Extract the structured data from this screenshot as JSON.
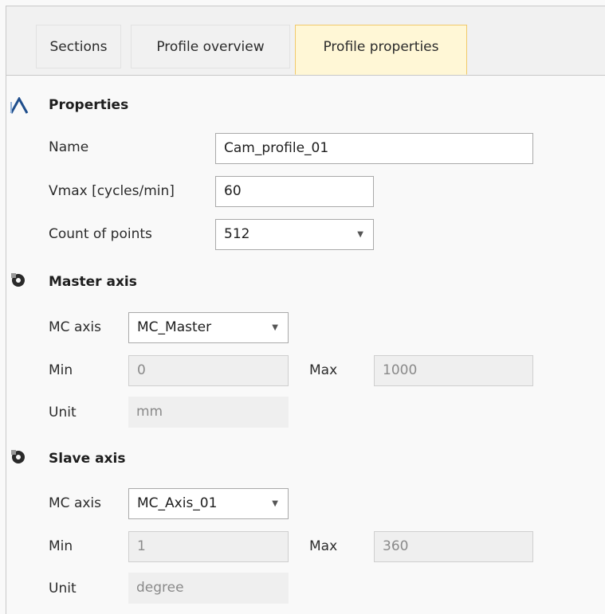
{
  "tabs": [
    {
      "label": "Sections"
    },
    {
      "label": "Profile overview"
    },
    {
      "label": "Profile properties"
    }
  ],
  "properties": {
    "title": "Properties",
    "name_label": "Name",
    "name_value": "Cam_profile_01",
    "vmax_label": "Vmax [cycles/min]",
    "vmax_value": "60",
    "count_label": "Count of points",
    "count_value": "512"
  },
  "master_axis": {
    "title": "Master axis",
    "mc_axis_label": "MC axis",
    "mc_axis_value": "MC_Master",
    "min_label": "Min",
    "min_value": "0",
    "max_label": "Max",
    "max_value": "1000",
    "unit_label": "Unit",
    "unit_value": "mm"
  },
  "slave_axis": {
    "title": "Slave axis",
    "mc_axis_label": "MC axis",
    "mc_axis_value": "MC_Axis_01",
    "min_label": "Min",
    "min_value": "1",
    "max_label": "Max",
    "max_value": "360",
    "unit_label": "Unit",
    "unit_value": "degree"
  },
  "icons": {
    "properties": "profile-curve-icon",
    "axis": "axis-icon",
    "dropdown": "chevron-down-icon"
  },
  "colors": {
    "active_tab_bg": "#fff7d6",
    "active_tab_border": "#f0c96b",
    "section_icon": "#1f4e8c"
  }
}
